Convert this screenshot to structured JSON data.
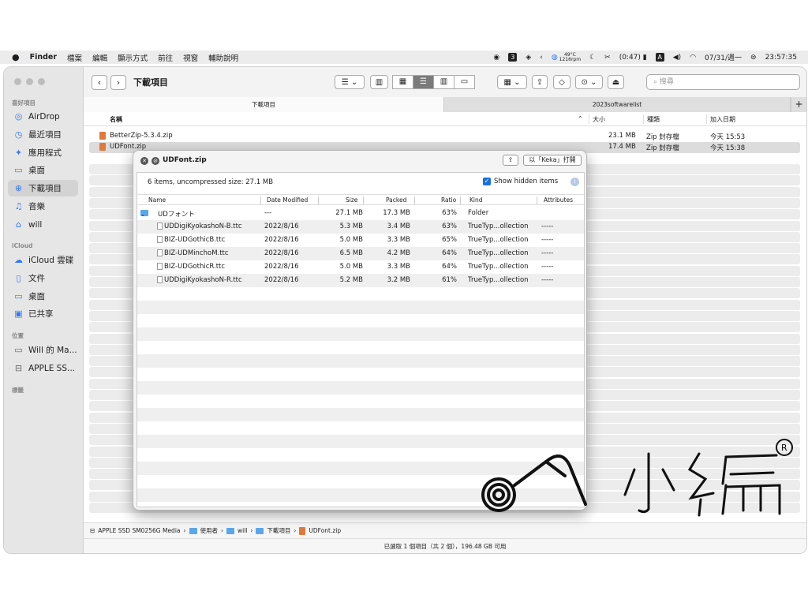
{
  "menubar": {
    "apple": "",
    "app": "Finder",
    "items": [
      "檔案",
      "編輯",
      "顯示方式",
      "前往",
      "視窗",
      "輔助說明"
    ],
    "temp": "49°C",
    "rpm": "1216rpm",
    "battery": "(0:47)",
    "date": "07/31/週一",
    "time": "23:57:35",
    "badge_3": "3",
    "input_a": "A"
  },
  "sidebar": {
    "favorites_title": "喜好項目",
    "favorites": [
      {
        "label": "AirDrop",
        "icon": "airdrop-icon",
        "glyph": "◎"
      },
      {
        "label": "最近項目",
        "icon": "clock-icon",
        "glyph": "◷"
      },
      {
        "label": "應用程式",
        "icon": "apps-icon",
        "glyph": "✦"
      },
      {
        "label": "桌面",
        "icon": "desktop-icon",
        "glyph": "▭"
      },
      {
        "label": "下載項目",
        "icon": "download-icon",
        "glyph": "⊕"
      },
      {
        "label": "音樂",
        "icon": "music-icon",
        "glyph": "♫"
      },
      {
        "label": "will",
        "icon": "home-icon",
        "glyph": "⌂"
      }
    ],
    "icloud_title": "iCloud",
    "icloud": [
      {
        "label": "iCloud 雲碟",
        "icon": "cloud-icon",
        "glyph": "☁"
      },
      {
        "label": "文件",
        "icon": "doc-icon",
        "glyph": "▯"
      },
      {
        "label": "桌面",
        "icon": "desktop-icon",
        "glyph": "▭"
      },
      {
        "label": "已共享",
        "icon": "shared-folder-icon",
        "glyph": "▣"
      }
    ],
    "locations_title": "位置",
    "locations": [
      {
        "label": "Will 的 Ma...",
        "icon": "laptop-icon",
        "glyph": "▭"
      },
      {
        "label": "APPLE SS...",
        "icon": "disk-icon",
        "glyph": "⊟"
      }
    ],
    "tags_title": "標籤"
  },
  "toolbar": {
    "back": "‹",
    "forward": "›",
    "title": "下載項目",
    "search_placeholder": "搜尋"
  },
  "tabs": {
    "active": "下載項目",
    "other": "2023softwarelist",
    "plus": "+"
  },
  "columns": {
    "name": "名稱",
    "size": "大小",
    "kind": "種類",
    "added": "加入日期"
  },
  "files": [
    {
      "name": "BetterZip-5.3.4.zip",
      "size": "23.1 MB",
      "kind": "Zip 封存檔",
      "added": "今天 15:53"
    },
    {
      "name": "UDFont.zip",
      "size": "17.4 MB",
      "kind": "Zip 封存檔",
      "added": "今天 15:38"
    }
  ],
  "pathbar": [
    "APPLE SSD SM0256G Media",
    "使用者",
    "will",
    "下載項目",
    "UDFont.zip"
  ],
  "status": "已選取 1 個項目（共 2 個），196.48 GB 可用",
  "betterzip": {
    "title": "UDFont.zip",
    "open_with": "以「Keka」打開",
    "info": "6 items, uncompressed size: 27.1 MB",
    "show_hidden": "Show hidden items",
    "headers": {
      "name": "Name",
      "date": "Date Modified",
      "size": "Size",
      "packed": "Packed",
      "ratio": "Ratio",
      "kind": "Kind",
      "attr": "Attributes"
    },
    "rows": [
      {
        "name": "UDフォント",
        "date": "---",
        "size": "27.1 MB",
        "packed": "17.3 MB",
        "ratio": "63%",
        "kind": "Folder",
        "attr": ""
      },
      {
        "name": "UDDigiKyokashoN-B.ttc",
        "date": "2022/8/16",
        "size": "5.3 MB",
        "packed": "3.4 MB",
        "ratio": "63%",
        "kind": "TrueTyp...ollection",
        "attr": "-----"
      },
      {
        "name": "BIZ-UDGothicB.ttc",
        "date": "2022/8/16",
        "size": "5.0 MB",
        "packed": "3.3 MB",
        "ratio": "65%",
        "kind": "TrueTyp...ollection",
        "attr": "-----"
      },
      {
        "name": "BIZ-UDMinchoM.ttc",
        "date": "2022/8/16",
        "size": "6.5 MB",
        "packed": "4.2 MB",
        "ratio": "64%",
        "kind": "TrueTyp...ollection",
        "attr": "-----"
      },
      {
        "name": "BIZ-UDGothicR.ttc",
        "date": "2022/8/16",
        "size": "5.0 MB",
        "packed": "3.3 MB",
        "ratio": "64%",
        "kind": "TrueTyp...ollection",
        "attr": "-----"
      },
      {
        "name": "UDDigiKyokashoN-R.ttc",
        "date": "2022/8/16",
        "size": "5.2 MB",
        "packed": "3.2 MB",
        "ratio": "61%",
        "kind": "TrueTyp...ollection",
        "attr": "-----"
      }
    ]
  },
  "watermark": {
    "text": "小編",
    "mark": "R"
  }
}
